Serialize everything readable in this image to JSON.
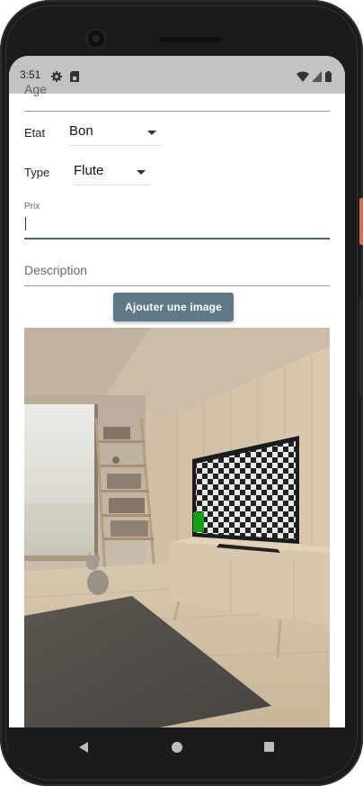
{
  "status_bar": {
    "time": "3:51",
    "left_icons": [
      "gear-icon",
      "sim-card-icon"
    ],
    "right_icons": [
      "wifi-icon",
      "signal-icon",
      "battery-icon"
    ]
  },
  "form": {
    "age_label": "Age",
    "etat": {
      "label": "Etat",
      "value": "Bon"
    },
    "type": {
      "label": "Type",
      "value": "Flute"
    },
    "prix": {
      "label": "Prix",
      "value": ""
    },
    "description": {
      "placeholder": "Description",
      "value": ""
    },
    "add_image_button": "Ajouter une image"
  },
  "colors": {
    "accent": "#5f7986",
    "focus_underline": "#4b6577",
    "status_bar": "#c3c3c3",
    "phone_frame": "#1b1b1b"
  },
  "nav_bar": {
    "icons": [
      "back-icon",
      "home-icon",
      "recents-icon"
    ]
  }
}
